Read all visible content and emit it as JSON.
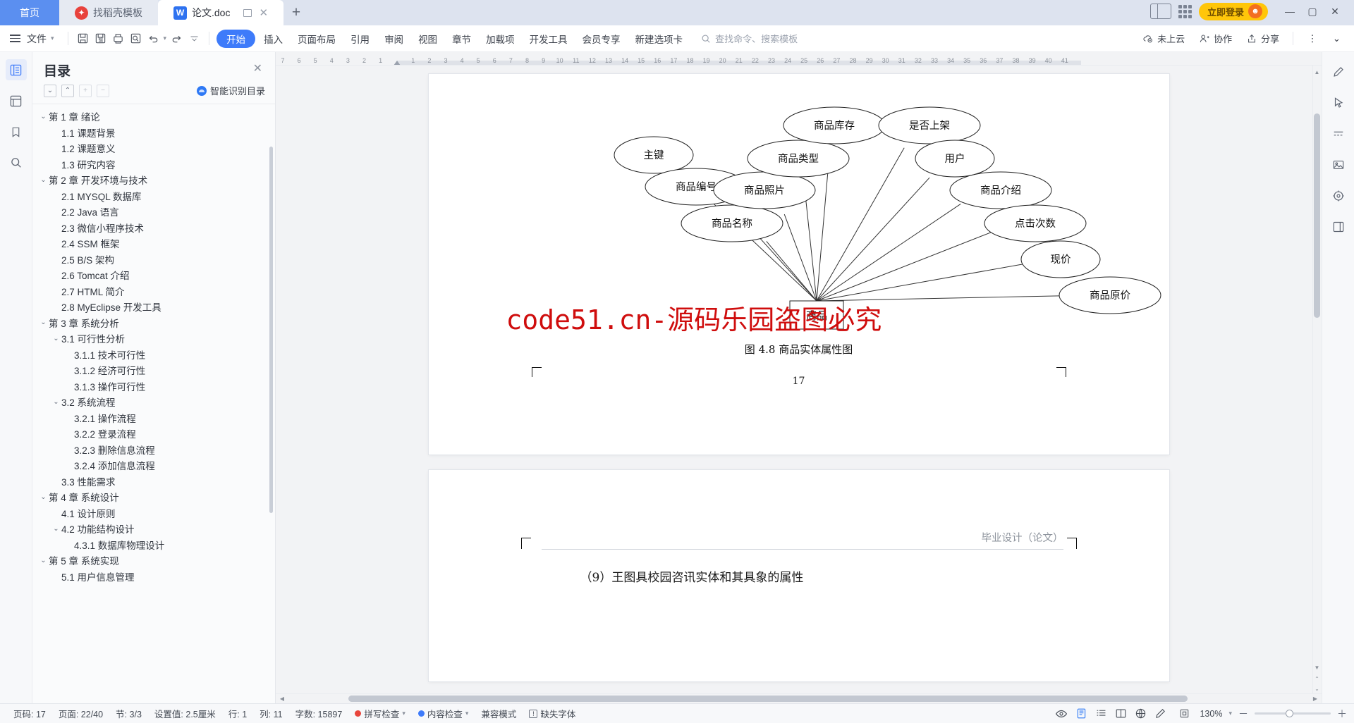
{
  "window": {
    "tabs": [
      {
        "label": "首页",
        "kind": "home"
      },
      {
        "label": "找稻壳模板",
        "kind": "inactive",
        "icon": "daoke-icon"
      },
      {
        "label": "论文.doc",
        "kind": "active",
        "icon": "word-icon"
      }
    ],
    "new_tab_label": "+",
    "login_label": "立即登录",
    "minimize": "—",
    "maximize": "▢",
    "close": "✕"
  },
  "ribbon": {
    "file_label": "文件",
    "tabs": [
      {
        "label": "开始",
        "active": true
      },
      {
        "label": "插入",
        "active": false
      },
      {
        "label": "页面布局",
        "active": false
      },
      {
        "label": "引用",
        "active": false
      },
      {
        "label": "审阅",
        "active": false
      },
      {
        "label": "视图",
        "active": false
      },
      {
        "label": "章节",
        "active": false
      },
      {
        "label": "加载项",
        "active": false
      },
      {
        "label": "开发工具",
        "active": false
      },
      {
        "label": "会员专享",
        "active": false
      },
      {
        "label": "新建选项卡",
        "active": false
      }
    ],
    "search_placeholder": "查找命令、搜索模板",
    "right_items": [
      {
        "label": "未上云",
        "icon": "cloud-off-icon"
      },
      {
        "label": "协作",
        "icon": "collaborate-icon"
      },
      {
        "label": "分享",
        "icon": "share-icon"
      }
    ],
    "more_label": "⋮",
    "collapse_label": "⌄"
  },
  "toc": {
    "title": "目录",
    "close_label": "✕",
    "tools": [
      "⌄",
      "⌃",
      "+",
      "−"
    ],
    "smart_label": "智能识别目录",
    "items": [
      {
        "label": "第 1 章 绪论",
        "level": 0,
        "chev": "⌄"
      },
      {
        "label": "1.1 课题背景",
        "level": 1,
        "chev": ""
      },
      {
        "label": "1.2 课题意义",
        "level": 1,
        "chev": ""
      },
      {
        "label": "1.3 研究内容",
        "level": 1,
        "chev": ""
      },
      {
        "label": "第 2 章 开发环境与技术",
        "level": 0,
        "chev": "⌄"
      },
      {
        "label": "2.1 MYSQL 数据库",
        "level": 1,
        "chev": ""
      },
      {
        "label": "2.2 Java 语言",
        "level": 1,
        "chev": ""
      },
      {
        "label": "2.3 微信小程序技术",
        "level": 1,
        "chev": ""
      },
      {
        "label": "2.4 SSM 框架",
        "level": 1,
        "chev": ""
      },
      {
        "label": "2.5 B/S 架构",
        "level": 1,
        "chev": ""
      },
      {
        "label": "2.6 Tomcat 介绍",
        "level": 1,
        "chev": ""
      },
      {
        "label": "2.7 HTML 简介",
        "level": 1,
        "chev": ""
      },
      {
        "label": "2.8 MyEclipse 开发工具",
        "level": 1,
        "chev": ""
      },
      {
        "label": "第 3 章 系统分析",
        "level": 0,
        "chev": "⌄"
      },
      {
        "label": "3.1 可行性分析",
        "level": 1,
        "chev": "⌄"
      },
      {
        "label": "3.1.1 技术可行性",
        "level": 2,
        "chev": ""
      },
      {
        "label": "3.1.2 经济可行性",
        "level": 2,
        "chev": ""
      },
      {
        "label": "3.1.3 操作可行性",
        "level": 2,
        "chev": ""
      },
      {
        "label": "3.2 系统流程",
        "level": 1,
        "chev": "⌄"
      },
      {
        "label": "3.2.1 操作流程",
        "level": 2,
        "chev": ""
      },
      {
        "label": "3.2.2 登录流程",
        "level": 2,
        "chev": ""
      },
      {
        "label": "3.2.3 删除信息流程",
        "level": 2,
        "chev": ""
      },
      {
        "label": "3.2.4 添加信息流程",
        "level": 2,
        "chev": ""
      },
      {
        "label": "3.3 性能需求",
        "level": 1,
        "chev": ""
      },
      {
        "label": "第 4 章 系统设计",
        "level": 0,
        "chev": "⌄"
      },
      {
        "label": "4.1 设计原则",
        "level": 1,
        "chev": ""
      },
      {
        "label": "4.2 功能结构设计",
        "level": 1,
        "chev": "⌄"
      },
      {
        "label": "4.3.1 数据库物理设计",
        "level": 2,
        "chev": ""
      },
      {
        "label": "第 5 章 系统实现",
        "level": 0,
        "chev": "⌄"
      },
      {
        "label": "5.1 用户信息管理",
        "level": 1,
        "chev": ""
      }
    ]
  },
  "ruler": {
    "ticks": [
      "7",
      "6",
      "5",
      "4",
      "3",
      "2",
      "1",
      "",
      "1",
      "2",
      "3",
      "4",
      "5",
      "6",
      "7",
      "8",
      "9",
      "10",
      "11",
      "12",
      "13",
      "14",
      "15",
      "16",
      "17",
      "18",
      "19",
      "20",
      "21",
      "22",
      "23",
      "24",
      "25",
      "26",
      "27",
      "28",
      "29",
      "30",
      "31",
      "32",
      "33",
      "34",
      "35",
      "36",
      "37",
      "38",
      "39",
      "40",
      "41"
    ]
  },
  "document": {
    "diagram": {
      "entity": "商品",
      "attributes": [
        "主键",
        "商品编号",
        "商品名称",
        "商品照片",
        "商品类型",
        "商品库存",
        "是否上架",
        "用户",
        "商品介绍",
        "点击次数",
        "现价",
        "商品原价"
      ]
    },
    "figure_caption": "图 4.8 商品实体属性图",
    "watermark": "code51.cn-源码乐园盗图必究",
    "page_number": "17",
    "next_page_header": "毕业设计（论文）",
    "next_page_text": "（9）王图具校园咨讯实体和其具象的属性"
  },
  "status": {
    "page": "页码: 17",
    "pages": "页面: 22/40",
    "sections": "节: 3/3",
    "value": "设置值: 2.5厘米",
    "row": "行: 1",
    "col": "列: 11",
    "words": "字数: 15897",
    "spellcheck": "拼写检查",
    "content_check": "内容检查",
    "compat": "兼容模式",
    "missing_font": "缺失字体",
    "zoom": "130%",
    "zoom_out": "－",
    "zoom_in": "＋"
  },
  "colors": {
    "accent": "#3e7bfa",
    "home_tab": "#5b8ff0",
    "login_yellow": "#ffc60a",
    "watermark_red": "#cf0d0d",
    "tabbar_bg": "#dde3ef"
  }
}
